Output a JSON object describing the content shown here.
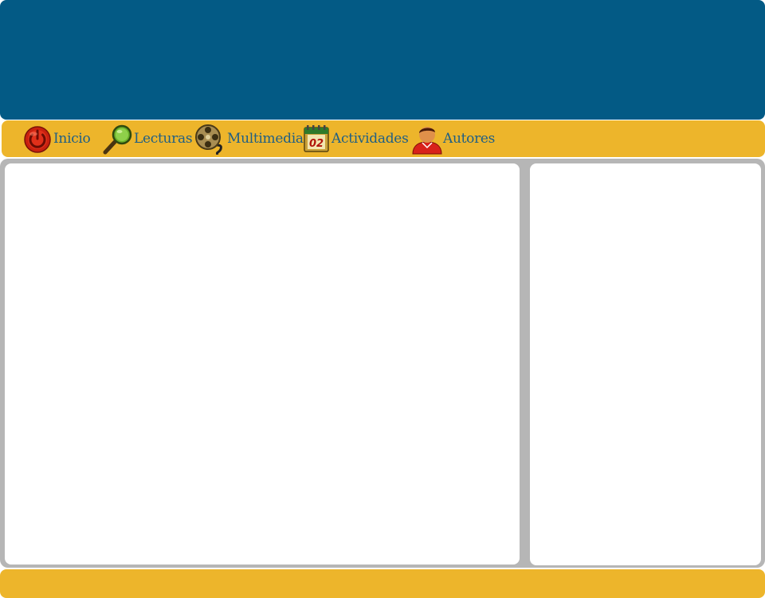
{
  "nav": {
    "items": [
      {
        "label": "Inicio",
        "icon": "power-icon"
      },
      {
        "label": "Lecturas",
        "icon": "magnifier-icon"
      },
      {
        "label": "Multimedia",
        "icon": "film-reel-icon"
      },
      {
        "label": "Actividades",
        "icon": "calendar-icon"
      },
      {
        "label": "Autores",
        "icon": "user-icon"
      }
    ],
    "calendar_day": "02"
  },
  "colors": {
    "header": "#035a85",
    "navbar": "#edb52b",
    "nav_text": "#1f5f85",
    "frame": "#b6b6b6",
    "panel": "#ffffff",
    "footer": "#edb52b"
  }
}
